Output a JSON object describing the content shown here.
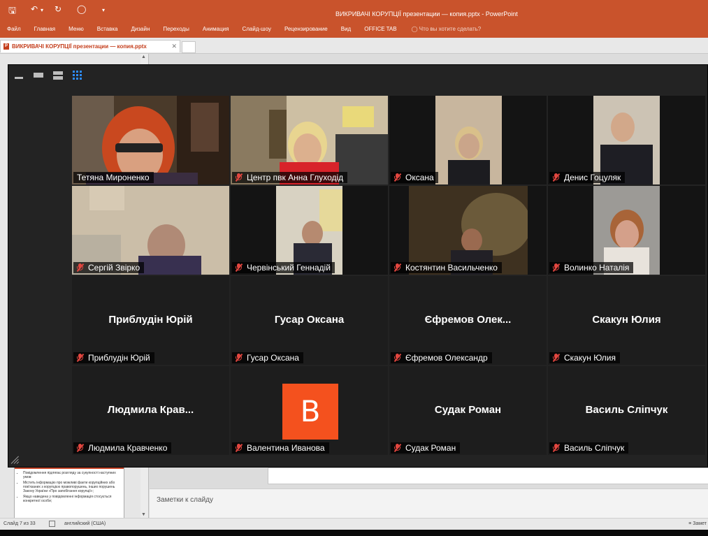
{
  "powerpoint": {
    "title": "ВИКРИВАЧІ КОРУПЦІЇ презентации — копия.pptx - PowerPoint",
    "ribbon_tabs": [
      "Файл",
      "Главная",
      "Меню",
      "Вставка",
      "Дизайн",
      "Переходы",
      "Анимация",
      "Слайд-шоу",
      "Рецензирование",
      "Вид",
      "OFFICE TAB"
    ],
    "tell_me": "Что вы хотите сделать?",
    "document_tab": "ВИКРИВАЧІ КОРУПЦІЇ презентации — копия.pptx",
    "notes_placeholder": "Заметки к слайду",
    "thumbnail_bullets": [
      "Повідомлення підлягає розгляду за сукупності наступних умов:",
      "Містить інформацію про можливі факти корупційних або пов'язаних з корупцією правопорушень, інших порушень Закону України «Про запобігання корупції»;",
      "Якщо наведена у повідомленні інформація стосується конкретної особи;"
    ],
    "status": {
      "slide_counter": "Слайд 7 из 33",
      "language": "английский (США)",
      "notes": "Замет"
    }
  },
  "zoom": {
    "view_modes": [
      "minimize-view",
      "speaker-view",
      "thumbnail-view",
      "gallery-view"
    ],
    "active_view": "gallery-view",
    "participants": [
      {
        "name": "Тетяна Мироненко",
        "video": true,
        "muted": false,
        "active_speaker": true
      },
      {
        "name": "Центр пвк Анна Глуходід",
        "video": true,
        "muted": true
      },
      {
        "name": "Оксана",
        "video": true,
        "muted": true
      },
      {
        "name": "Денис Гоцуляк",
        "video": true,
        "muted": true
      },
      {
        "name": "Сергій Звірко",
        "video": true,
        "muted": true
      },
      {
        "name": "Червінський Геннадій",
        "video": true,
        "muted": true
      },
      {
        "name": "Костянтин Васильченко",
        "video": true,
        "muted": true
      },
      {
        "name": "Волинко Наталія",
        "video": true,
        "muted": true
      },
      {
        "name": "Приблудін Юрій",
        "display": "Приблудін Юрій",
        "video": false,
        "muted": true
      },
      {
        "name": "Гусар Оксана",
        "display": "Гусар Оксана",
        "video": false,
        "muted": true
      },
      {
        "name": "Єфремов Олександр",
        "display": "Єфремов  Олек...",
        "video": false,
        "muted": true
      },
      {
        "name": "Скакун Юлия",
        "display": "Скакун Юлия",
        "video": false,
        "muted": true
      },
      {
        "name": "Людмила Кравченко",
        "display": "Людмила  Крав...",
        "video": false,
        "muted": true
      },
      {
        "name": "Валентина Иванова",
        "avatar_letter": "B",
        "avatar_color": "#f4511e",
        "video": false,
        "muted": true
      },
      {
        "name": "Судак Роман",
        "display": "Судак Роман",
        "video": false,
        "muted": true
      },
      {
        "name": "Василь Сліпчук",
        "display": "Василь Сліпчук",
        "video": false,
        "muted": true
      }
    ]
  },
  "colors": {
    "powerpoint_accent": "#c9532c",
    "active_speaker_border": "#e8e873",
    "muted_icon": "#e2463f",
    "zoom_accent": "#2d8cff"
  }
}
